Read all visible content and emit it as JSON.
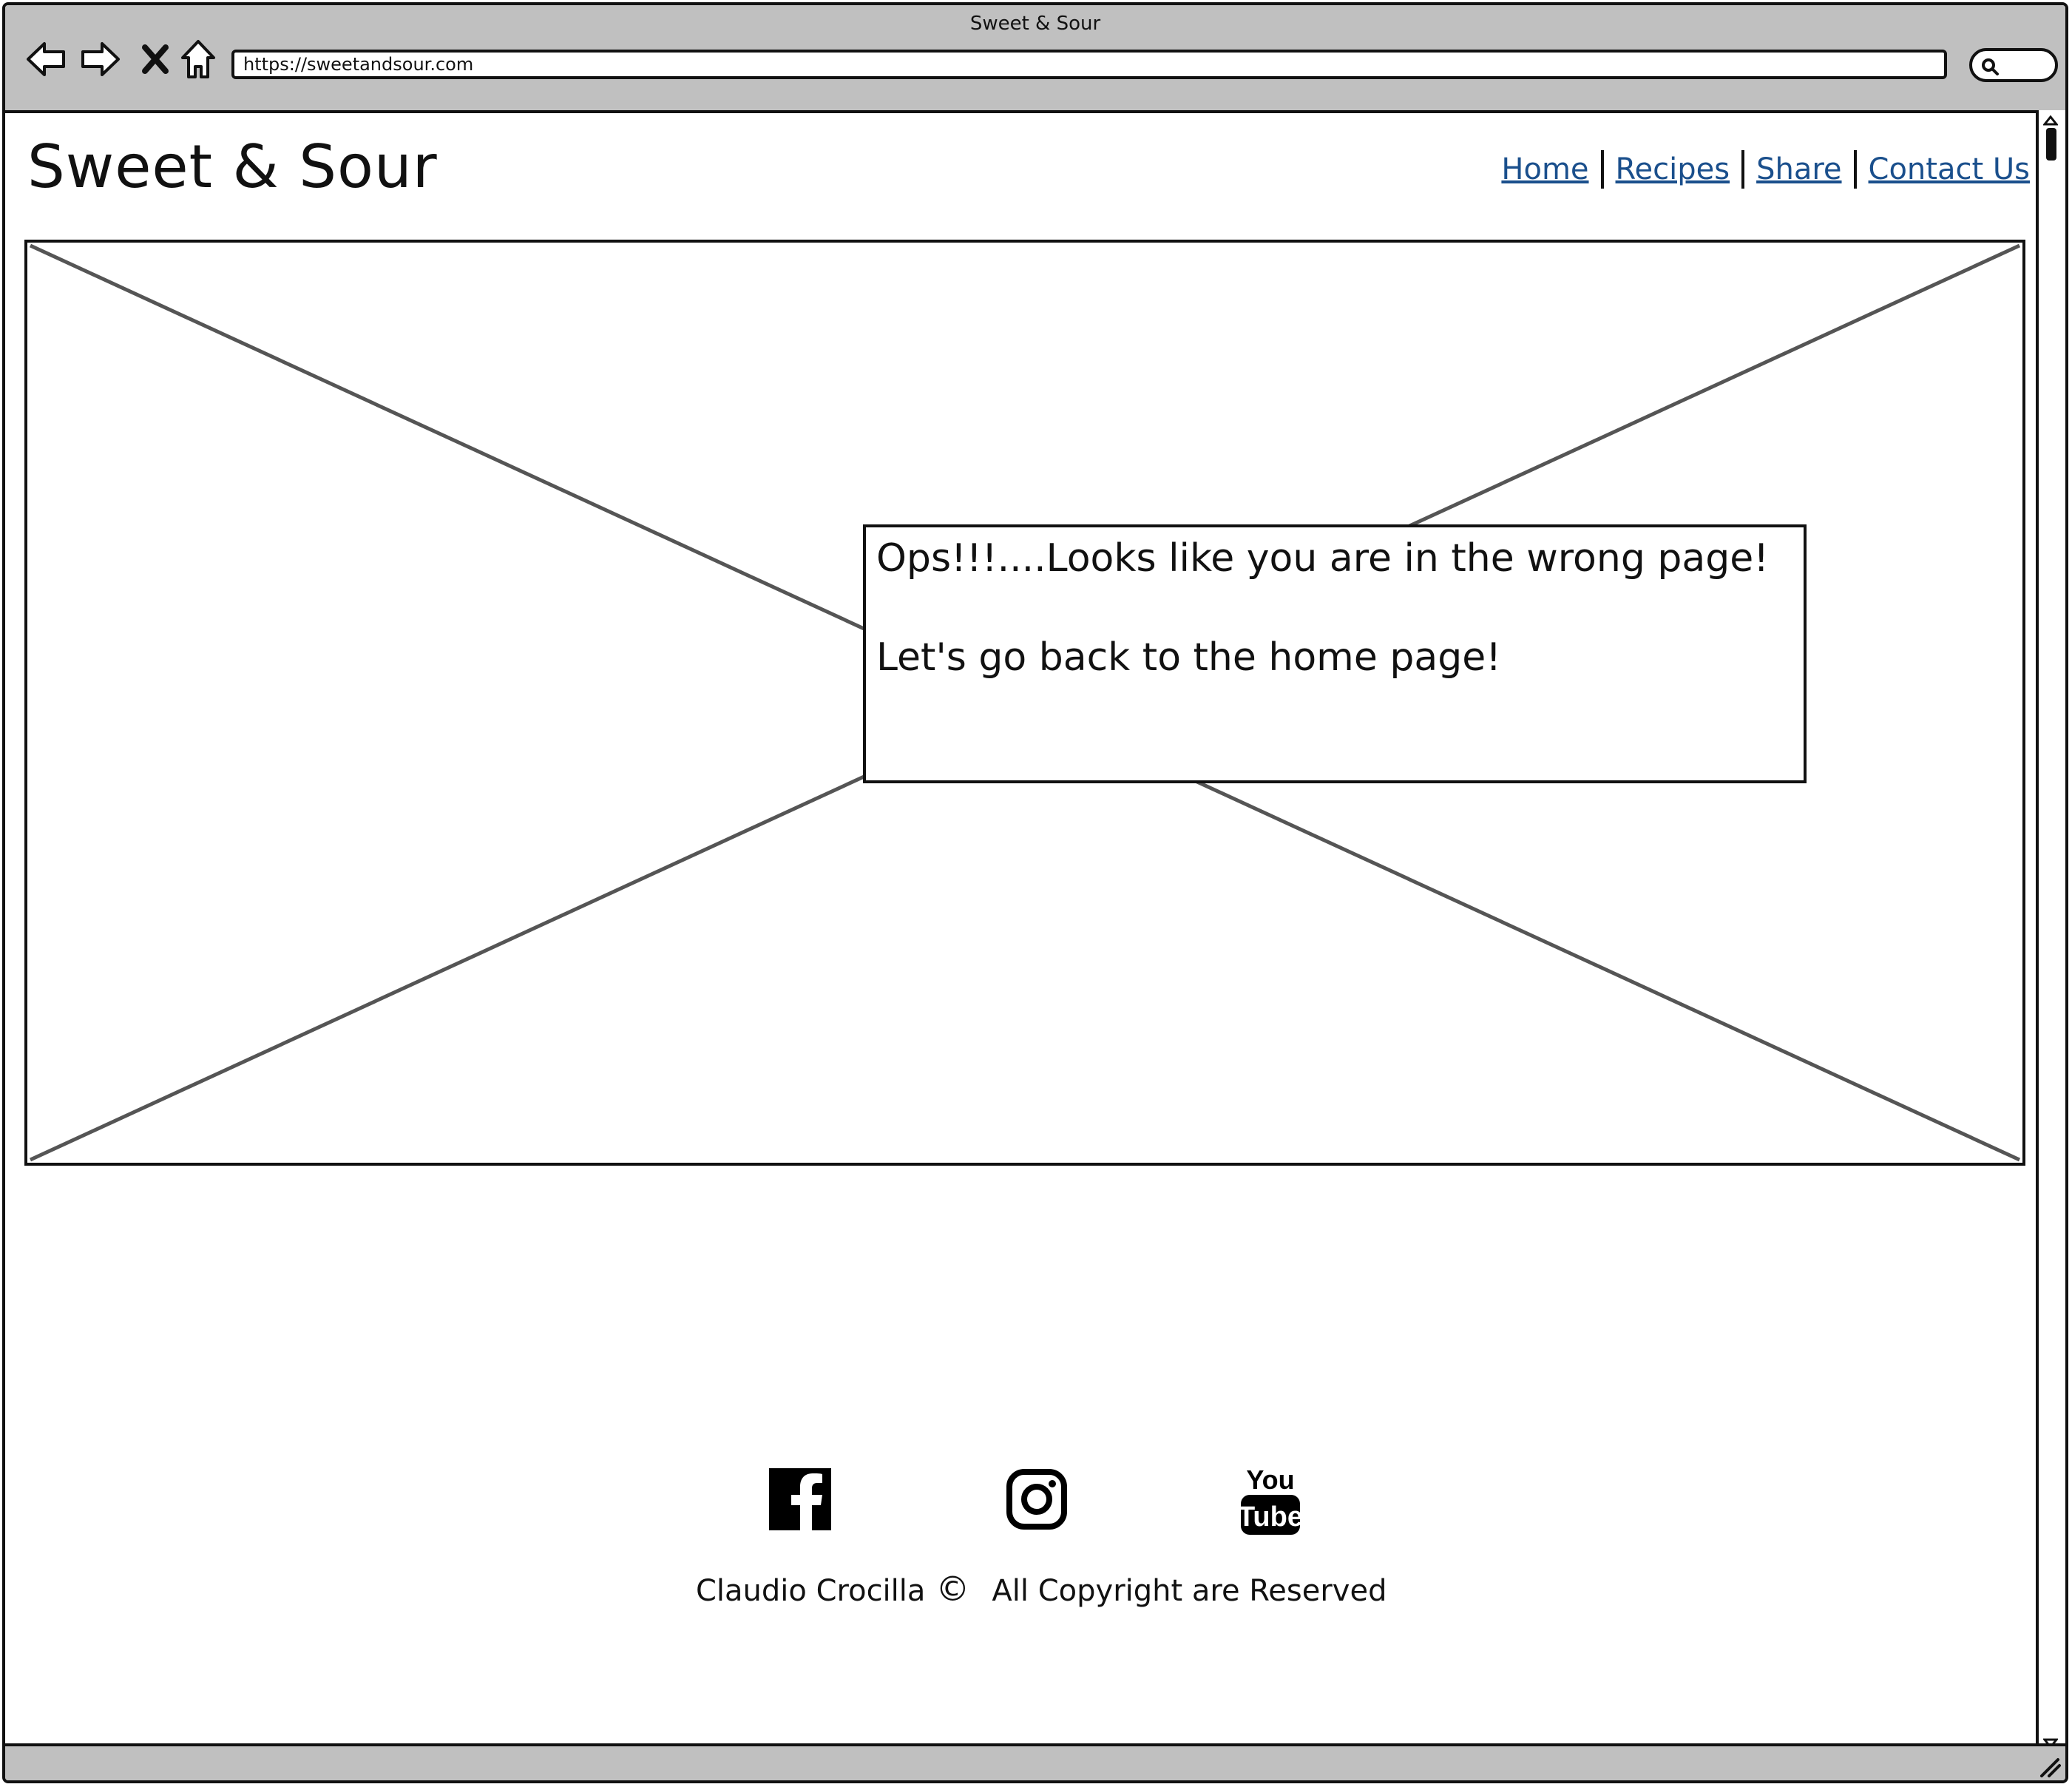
{
  "browser": {
    "window_title": "Sweet & Sour",
    "url": "https://sweetandsour.com",
    "icons": [
      "back-arrow-icon",
      "forward-arrow-icon",
      "stop-icon",
      "home-icon",
      "search-icon"
    ]
  },
  "header": {
    "site_title": "Sweet & Sour",
    "nav": [
      "Home",
      "Recipes",
      "Share",
      "Contact Us"
    ]
  },
  "hero": {
    "image_placeholder": "image-placeholder",
    "message_line1": "Ops!!!....Looks like you are in the wrong page!",
    "message_line2": "Let's go back to the home page!"
  },
  "footer": {
    "socials": [
      "facebook-icon",
      "instagram-icon",
      "youtube-icon"
    ],
    "youtube_you": "You",
    "youtube_tube": "Tube",
    "author": "Claudio Crocilla",
    "copyright_symbol": "©",
    "rights": "All Copyright are Reserved"
  },
  "colors": {
    "chrome_gray": "#c0c0c0",
    "link_blue": "#1a4f8c",
    "ink": "#111111"
  }
}
